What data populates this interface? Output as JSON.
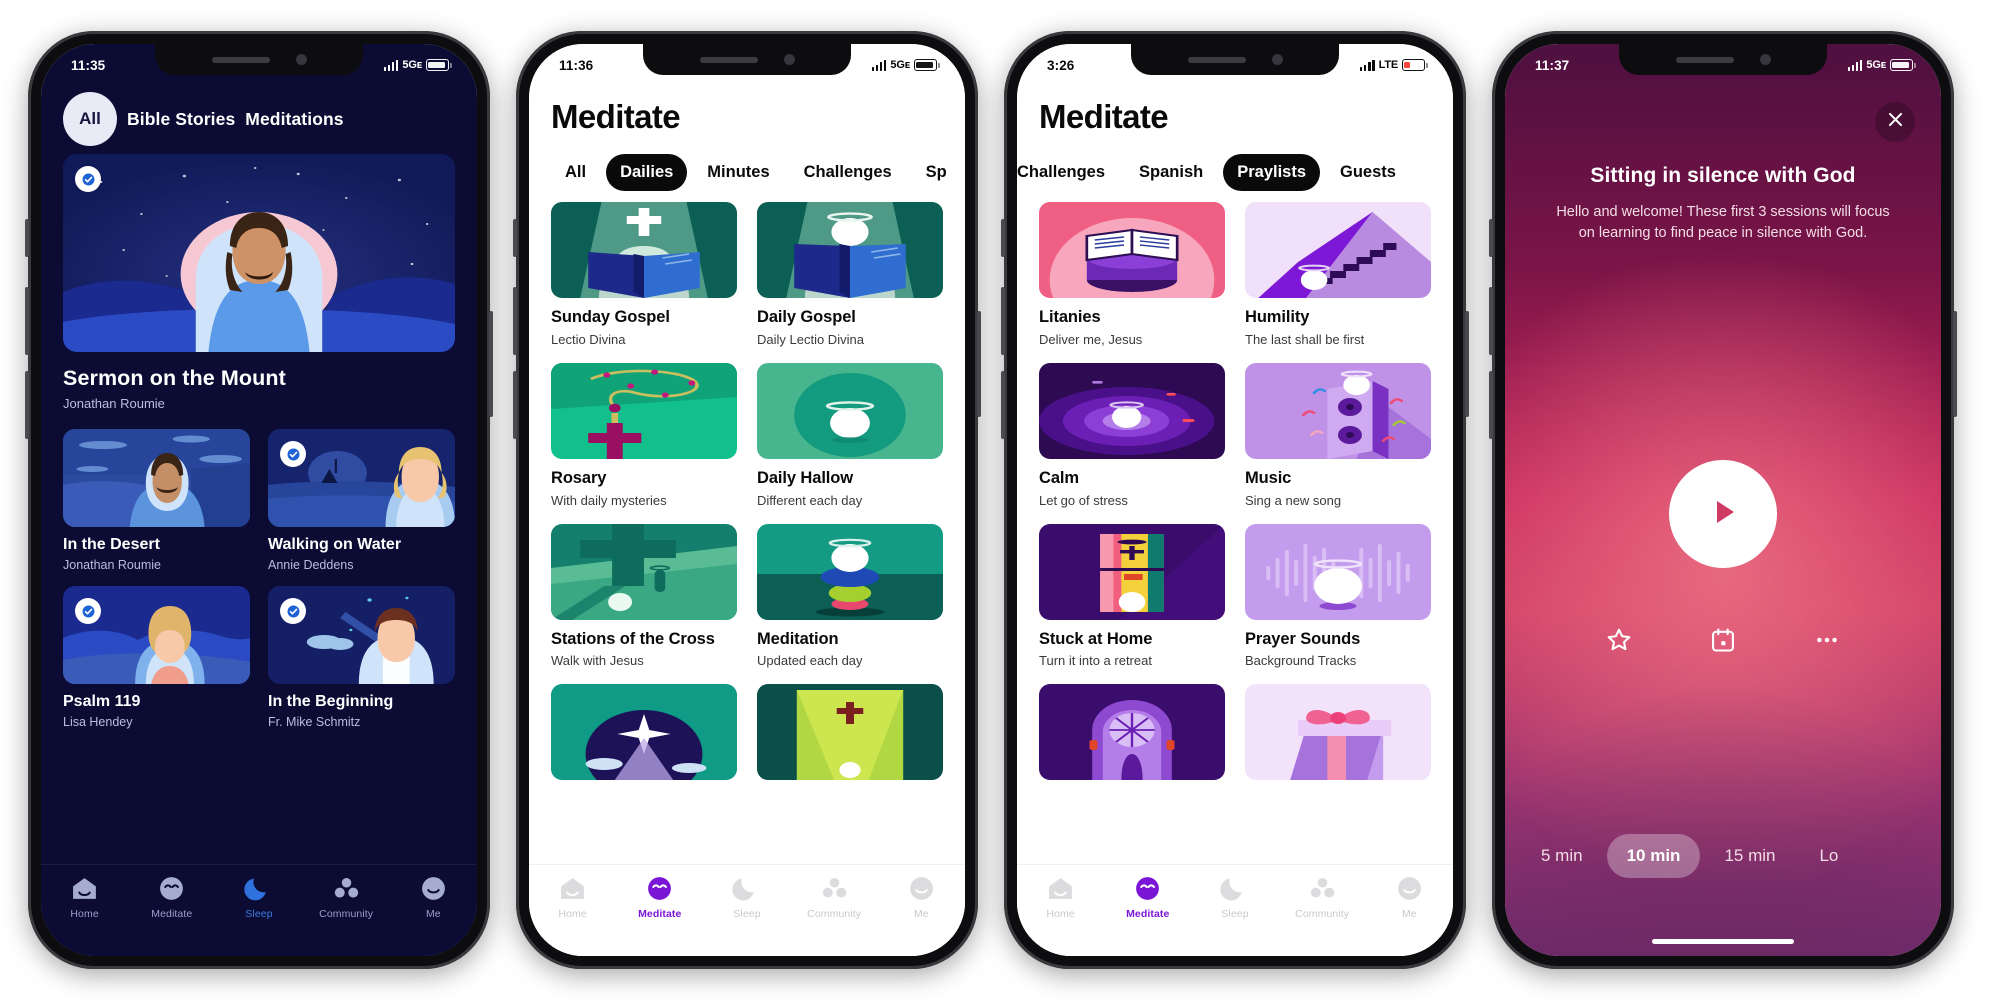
{
  "phones": [
    {
      "id": "phone-home-dark",
      "status": {
        "time": "11:35",
        "network": "5Gᴇ",
        "battery": "full"
      },
      "chips": [
        {
          "label": "All",
          "active": true
        },
        {
          "label": "Bible Stories",
          "active": false
        },
        {
          "label": "Meditations",
          "active": false
        }
      ],
      "hero": {
        "title": "Sermon on the Mount",
        "author": "Jonathan Roumie",
        "completed": true
      },
      "cards": [
        {
          "title": "In the Desert",
          "author": "Jonathan Roumie",
          "completed": false
        },
        {
          "title": "Walking on Water",
          "author": "Annie Deddens",
          "completed": true
        },
        {
          "title": "Psalm 119",
          "author": "Lisa Hendey",
          "completed": true
        },
        {
          "title": "In the Beginning",
          "author": "Fr. Mike Schmitz",
          "completed": true
        }
      ],
      "tabs": [
        {
          "label": "Home",
          "icon": "home-icon",
          "active": false
        },
        {
          "label": "Meditate",
          "icon": "face-icon",
          "active": false
        },
        {
          "label": "Sleep",
          "icon": "moon-icon",
          "active": true
        },
        {
          "label": "Community",
          "icon": "people-icon",
          "active": false
        },
        {
          "label": "Me",
          "icon": "profile-icon",
          "active": false
        }
      ]
    },
    {
      "id": "phone-meditate-dailies",
      "status": {
        "time": "11:36",
        "network": "5Gᴇ",
        "battery": "full"
      },
      "title": "Meditate",
      "tabs_row": [
        {
          "label": "All",
          "active": false
        },
        {
          "label": "Dailies",
          "active": true
        },
        {
          "label": "Minutes",
          "active": false
        },
        {
          "label": "Challenges",
          "active": false
        },
        {
          "label": "Sp",
          "active": false
        }
      ],
      "cards": [
        {
          "title": "Sunday Gospel",
          "subtitle": "Lectio Divina",
          "art": "book-cross"
        },
        {
          "title": "Daily Gospel",
          "subtitle": "Daily Lectio Divina",
          "art": "book-halo"
        },
        {
          "title": "Rosary",
          "subtitle": "With daily mysteries",
          "art": "rosary"
        },
        {
          "title": "Daily Hallow",
          "subtitle": "Different each day",
          "art": "circle-halo"
        },
        {
          "title": "Stations of the Cross",
          "subtitle": "Walk with Jesus",
          "art": "cross-shadow"
        },
        {
          "title": "Meditation",
          "subtitle": "Updated each day",
          "art": "stack-stones"
        },
        {
          "title": "",
          "subtitle": "",
          "art": "nativity-star"
        },
        {
          "title": "",
          "subtitle": "",
          "art": "chapel-cross"
        }
      ],
      "tabs": [
        {
          "label": "Home",
          "icon": "home-icon",
          "active": false
        },
        {
          "label": "Meditate",
          "icon": "face-icon",
          "active": true
        },
        {
          "label": "Sleep",
          "icon": "moon-icon",
          "active": false
        },
        {
          "label": "Community",
          "icon": "people-icon",
          "active": false
        },
        {
          "label": "Me",
          "icon": "profile-icon",
          "active": false
        }
      ]
    },
    {
      "id": "phone-meditate-praylists",
      "status": {
        "time": "3:26",
        "network": "LTE",
        "battery": "low"
      },
      "title": "Meditate",
      "tabs_row": [
        {
          "label": "Challenges",
          "active": false
        },
        {
          "label": "Spanish",
          "active": false
        },
        {
          "label": "Praylists",
          "active": true
        },
        {
          "label": "Guests",
          "active": false
        }
      ],
      "cards": [
        {
          "title": "Litanies",
          "subtitle": "Deliver me, Jesus",
          "art": "open-book-pink"
        },
        {
          "title": "Humility",
          "subtitle": "The last shall be first",
          "art": "stairs-mountain"
        },
        {
          "title": "Calm",
          "subtitle": "Let go of stress",
          "art": "ripples"
        },
        {
          "title": "Music",
          "subtitle": "Sing a new song",
          "art": "speaker-notes"
        },
        {
          "title": "Stuck at Home",
          "subtitle": "Turn it into a retreat",
          "art": "window-home"
        },
        {
          "title": "Prayer Sounds",
          "subtitle": "Background Tracks",
          "art": "waveform"
        },
        {
          "title": "",
          "subtitle": "",
          "art": "stained-glass"
        },
        {
          "title": "",
          "subtitle": "",
          "art": "gift-box"
        }
      ],
      "tabs": [
        {
          "label": "Home",
          "icon": "home-icon",
          "active": false
        },
        {
          "label": "Meditate",
          "icon": "face-icon",
          "active": true
        },
        {
          "label": "Sleep",
          "icon": "moon-icon",
          "active": false
        },
        {
          "label": "Community",
          "icon": "people-icon",
          "active": false
        },
        {
          "label": "Me",
          "icon": "profile-icon",
          "active": false
        }
      ]
    },
    {
      "id": "phone-player",
      "status": {
        "time": "11:37",
        "network": "5Gᴇ",
        "battery": "full"
      },
      "close_icon": "close-icon",
      "session_title": "Sitting in silence with God",
      "session_desc": "Hello and welcome! These first 3 sessions will focus on learning to find peace in silence with God.",
      "play_icon": "play-icon",
      "actions": [
        {
          "icon": "star-icon",
          "name": "favorite-button"
        },
        {
          "icon": "calendar-icon",
          "name": "schedule-button"
        },
        {
          "icon": "more-icon",
          "name": "more-options-button"
        }
      ],
      "durations": [
        {
          "label": "5 min",
          "active": false
        },
        {
          "label": "10 min",
          "active": true
        },
        {
          "label": "15 min",
          "active": false
        },
        {
          "label": "Lo",
          "active": false
        }
      ]
    }
  ],
  "colors": {
    "dark_bg": "#0b0b33",
    "accent_sleep": "#3f7fe0",
    "accent_meditate": "#7b15d6",
    "pill_active_bg": "#0a0a0a",
    "green_primary": "#0f8a78",
    "purple_primary": "#7b2fd0",
    "pink_primary": "#ef6f90"
  }
}
